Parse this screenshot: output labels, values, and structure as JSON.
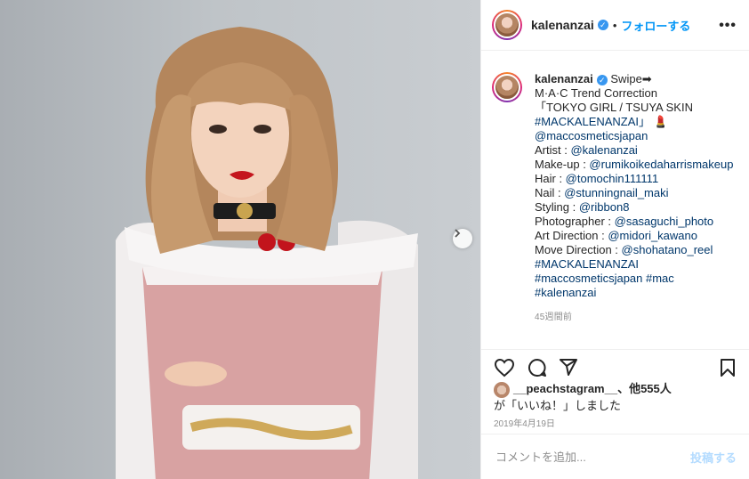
{
  "post": {
    "username": "kalenanzai",
    "follow_label": "フォローする",
    "more_label": "•••",
    "next_arrow": "chevron-right-icon"
  },
  "caption": {
    "username": "kalenanzai",
    "lines": [
      {
        "text": "Swipe➡",
        "link": false
      },
      {
        "text": "M·A·C Trend Correction",
        "link": false
      },
      {
        "text": "「TOKYO GIRL / TSUYA SKIN",
        "link": false
      },
      {
        "text": "#MACKALENANZAI」 💄",
        "link": true
      },
      {
        "text": "@maccosmeticsjapan",
        "link": true
      },
      {
        "text": "Artist : ",
        "link": false,
        "suffix": "@kalenanzai"
      },
      {
        "text": "Make-up : ",
        "link": false,
        "suffix": "@rumikoikedaharrismakeup"
      },
      {
        "text": "Hair : ",
        "link": false,
        "suffix": "@tomochin111111"
      },
      {
        "text": "Nail : ",
        "link": false,
        "suffix": "@stunningnail_maki"
      },
      {
        "text": "Styling : ",
        "link": false,
        "suffix": "@ribbon8"
      },
      {
        "text": "Photographer : ",
        "link": false,
        "suffix": "@sasaguchi_photo"
      },
      {
        "text": "Art Direction : ",
        "link": false,
        "suffix": "@midori_kawano"
      },
      {
        "text": "Move Direction : ",
        "link": false,
        "suffix": "@shohatano_reel"
      },
      {
        "text": "#MACKALENANZAI",
        "link": true
      },
      {
        "text": "#maccosmeticsjapan #mac",
        "link": true
      },
      {
        "text": "#kalenanzai",
        "link": true
      }
    ],
    "time_ago": "45週間前"
  },
  "likes": {
    "liker": "__peachstagram__",
    "others": "、他555人",
    "suffix": "が「いいね！」しました"
  },
  "date": "2019年4月19日",
  "comment": {
    "placeholder": "コメントを追加...",
    "post_label": "投稿する"
  },
  "icons": [
    "heart-icon",
    "comment-icon",
    "share-icon",
    "bookmark-icon"
  ],
  "colors": {
    "link": "#00376b",
    "follow": "#0095f6",
    "verified": "#3897f0",
    "post_disabled": "#b3dbff"
  }
}
